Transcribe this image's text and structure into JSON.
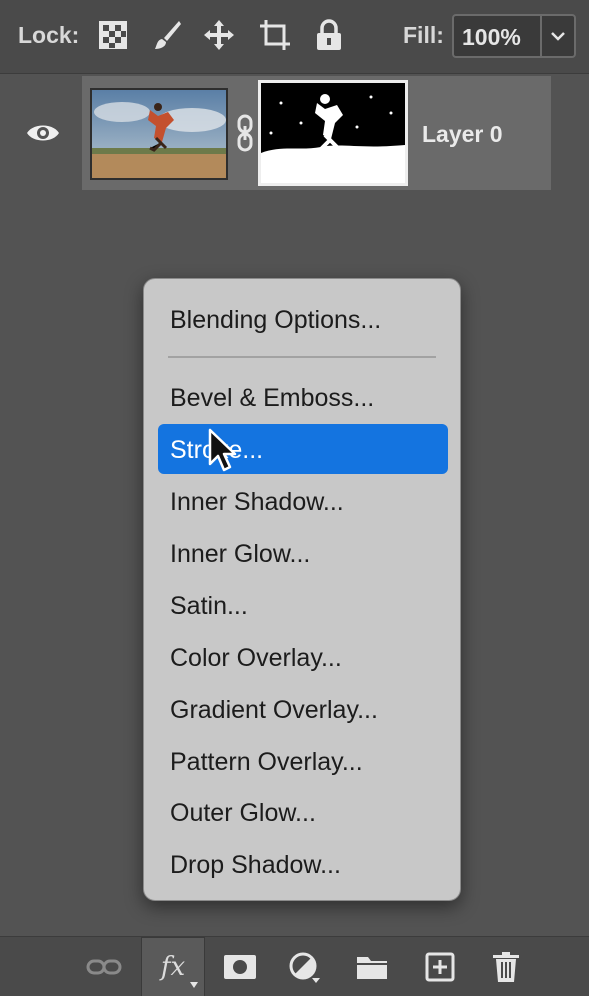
{
  "lock_bar": {
    "lock_label": "Lock:",
    "fill_label": "Fill:",
    "fill_value": "100%",
    "icons": [
      "lock-transparent-pixels-icon",
      "lock-image-pixels-icon",
      "lock-position-icon",
      "lock-artboard-icon",
      "lock-all-icon"
    ]
  },
  "layer": {
    "name": "Layer 0",
    "visible": true
  },
  "context_menu": {
    "items": [
      "Blending Options...",
      "Bevel & Emboss...",
      "Stroke...",
      "Inner Shadow...",
      "Inner Glow...",
      "Satin...",
      "Color Overlay...",
      "Gradient Overlay...",
      "Pattern Overlay...",
      "Outer Glow...",
      "Drop Shadow..."
    ],
    "highlighted": "Stroke..."
  },
  "bottom_bar": {
    "fx_label": "fx",
    "icons": [
      "link-layers-icon",
      "fx-icon",
      "add-mask-icon",
      "adjustment-layer-icon",
      "folder-icon",
      "new-layer-icon",
      "trash-icon"
    ]
  },
  "colors": {
    "panel_bg": "#535353",
    "menu_bg": "#c8c8c8",
    "highlight": "#1474e0"
  }
}
